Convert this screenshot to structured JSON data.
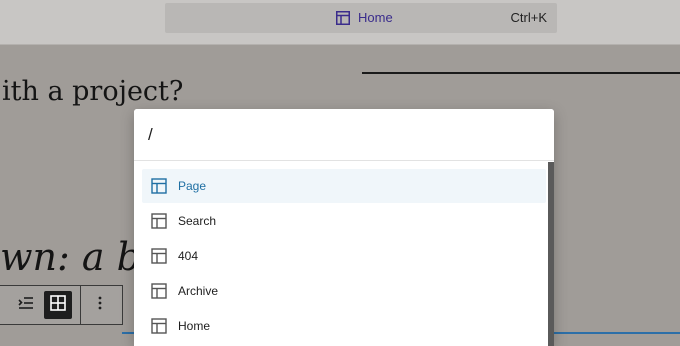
{
  "header": {
    "command_title": "Home",
    "shortcut": "Ctrl+K",
    "icon": "layout-template-icon"
  },
  "canvas": {
    "heading_text": "ith a project?",
    "italic_text": "wn: a b"
  },
  "palette": {
    "input_value": "/",
    "results": [
      {
        "label": "Page",
        "icon": "layout-template-icon",
        "selected": true
      },
      {
        "label": "Search",
        "icon": "layout-template-icon",
        "selected": false
      },
      {
        "label": "404",
        "icon": "layout-template-icon",
        "selected": false
      },
      {
        "label": "Archive",
        "icon": "layout-template-icon",
        "selected": false
      },
      {
        "label": "Home",
        "icon": "layout-template-icon",
        "selected": false
      }
    ]
  },
  "colors": {
    "accent": "#1f6fa3",
    "title_purple": "#3a2c8c",
    "overlay": "#a09c98"
  }
}
